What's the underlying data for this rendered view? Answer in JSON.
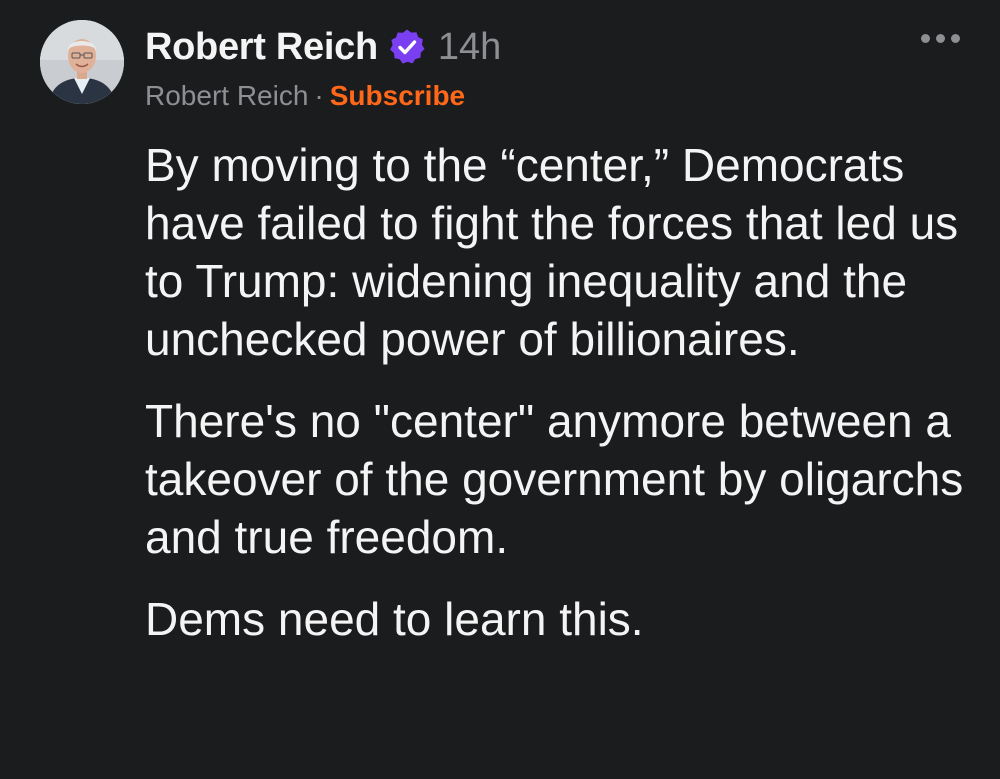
{
  "post": {
    "author_name": "Robert Reich",
    "timestamp": "14h",
    "publication_name": "Robert Reich",
    "separator": "·",
    "subscribe_label": "Subscribe",
    "paragraphs": [
      "By moving to the “center,” Democrats have failed to fight the forces that led us to Trump: widening inequality and the unchecked power of billionaires.",
      "There's no \"center\" anymore between a takeover of the government by oligarchs and true freedom.",
      "Dems need to learn this."
    ]
  },
  "icons": {
    "verified": "verified-badge-icon",
    "more": "more-options-icon"
  },
  "colors": {
    "background": "#1b1c1e",
    "text": "#f4f4f4",
    "muted": "#8e8e93",
    "subscribe": "#ff6719",
    "verified": "#7b3ff2"
  }
}
